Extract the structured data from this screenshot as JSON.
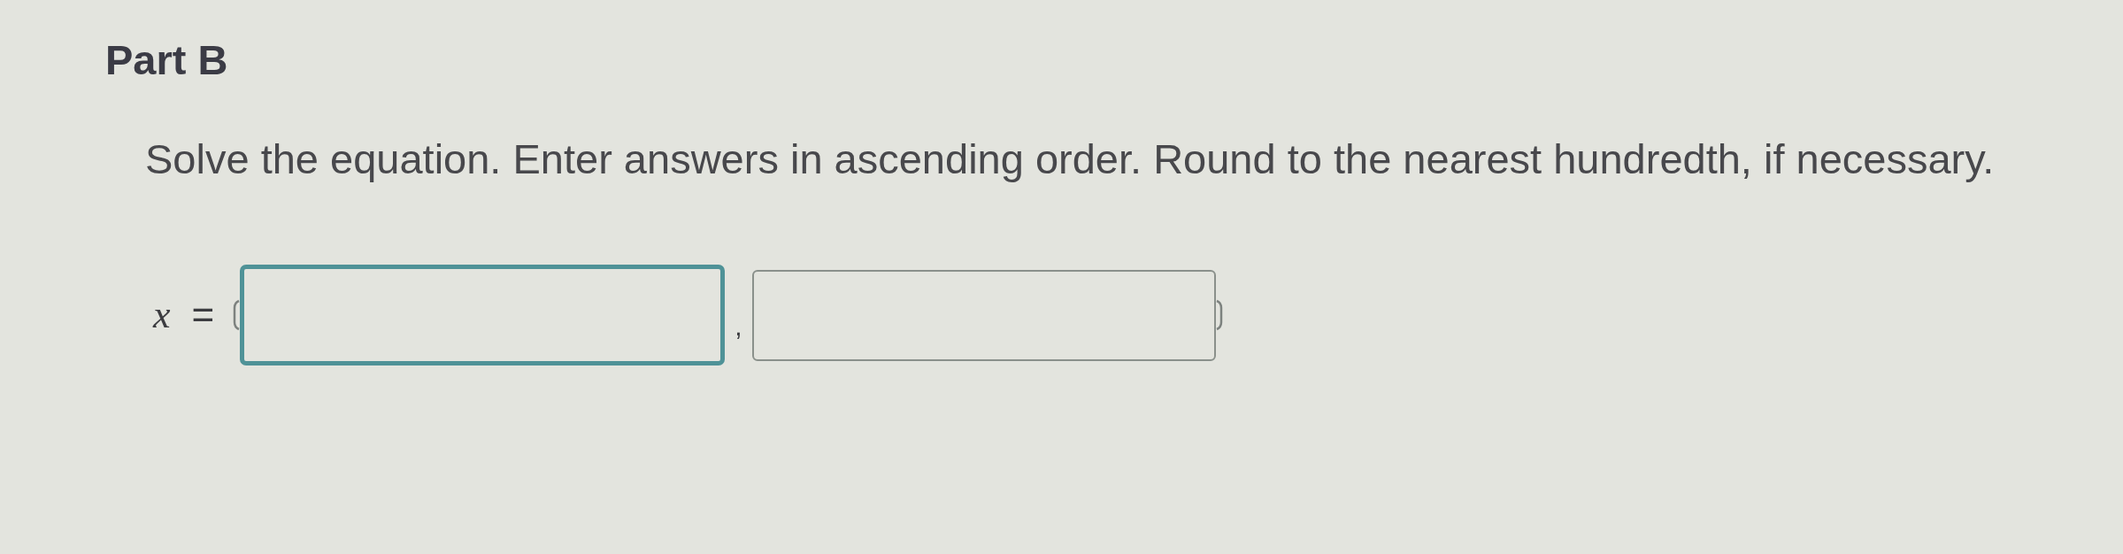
{
  "title": "Part B",
  "instructions": "Solve the equation. Enter answers in ascending order. Round to the nearest hundredth, if necessary.",
  "equation": {
    "variable": "x",
    "sign": "=",
    "separator": ",",
    "answer_fields": [
      {
        "focused": true
      },
      {
        "focused": false
      }
    ]
  }
}
